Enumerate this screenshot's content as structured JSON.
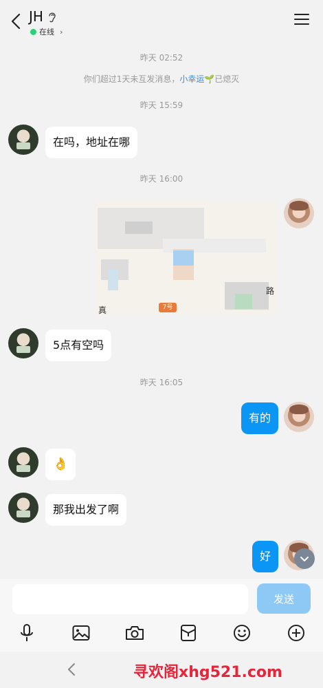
{
  "header": {
    "title": "JH",
    "status": "在线"
  },
  "messages": {
    "time1": "昨天 02:52",
    "system_prefix": "你们超过1天未互发消息，",
    "system_link": "小幸运",
    "system_suffix": "已熄灭",
    "time2": "昨天 15:59",
    "msg1": "在吗，地址在哪",
    "time3": "昨天 16:00",
    "msg2": "5点有空吗",
    "time4": "昨天 16:05",
    "msg3": "有的",
    "msg4": "👌",
    "msg5": "那我出发了啊",
    "msg6": "好"
  },
  "map": {
    "label_left": "真",
    "label_badge": "7号",
    "label_right": "路"
  },
  "input": {
    "placeholder": "",
    "send_label": "发送"
  },
  "toolbar": [
    "mic-icon",
    "image-icon",
    "camera-icon",
    "pocket-icon",
    "emoji-icon",
    "plus-icon"
  ],
  "watermark": "寻欢阁xhg521.com",
  "colors": {
    "accent": "#0b96f6",
    "send_disabled": "#8ec9f5",
    "online": "#29d17a",
    "link": "#3b8bd9",
    "watermark": "#e8243a"
  }
}
